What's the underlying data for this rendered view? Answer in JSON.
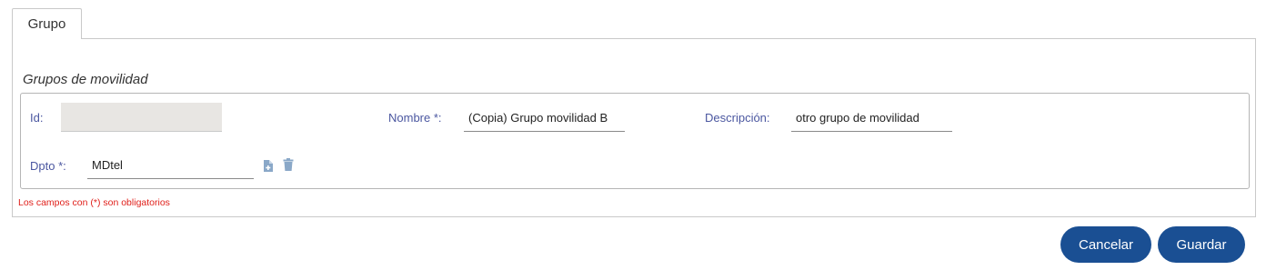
{
  "tabs": [
    {
      "label": "Grupo",
      "active": true
    }
  ],
  "section": {
    "title": "Grupos de movilidad"
  },
  "form": {
    "id": {
      "label": "Id:",
      "value": ""
    },
    "nombre": {
      "label": "Nombre *:",
      "value": "(Copia) Grupo movilidad B"
    },
    "descripcion": {
      "label": "Descripción:",
      "value": "otro grupo de movilidad"
    },
    "dpto": {
      "label": "Dpto *:",
      "value": "MDtel",
      "icons": [
        "add-document-icon",
        "trash-icon"
      ]
    }
  },
  "required_note": "Los campos con (*) son obligatorios",
  "actions": {
    "cancel_label": "Cancelar",
    "save_label": "Guardar"
  },
  "colors": {
    "label": "#4b57a0",
    "button": "#1a4f93",
    "required_note": "#e0201b",
    "icon": "#8aa8c8"
  }
}
